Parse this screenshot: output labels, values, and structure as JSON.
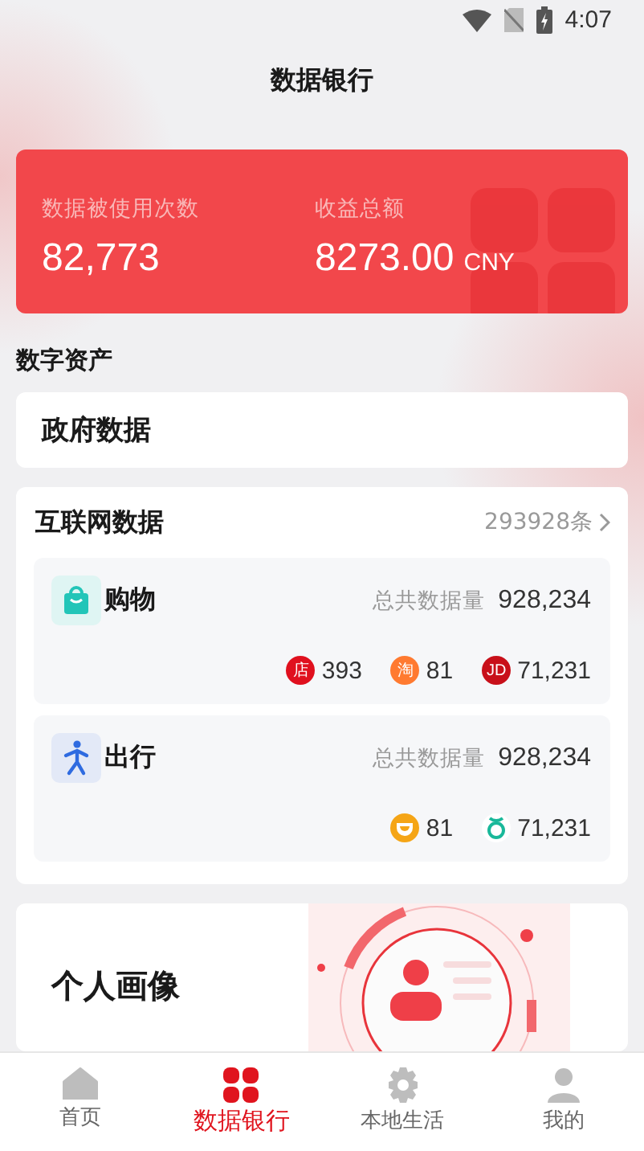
{
  "status_bar": {
    "time": "4:07"
  },
  "header": {
    "title": "数据银行"
  },
  "summary": {
    "stats": [
      {
        "label": "数据被使用次数",
        "value": "82,773"
      },
      {
        "label": "收益总额",
        "value": "8273.00",
        "unit": "CNY"
      }
    ]
  },
  "section_title": "数字资产",
  "government": {
    "title": "政府数据"
  },
  "internet": {
    "title": "互联网数据",
    "count": "293928条",
    "categories": [
      {
        "kind": "shopping",
        "name": "购物",
        "total_label": "总共数据量",
        "total": "928,234",
        "sources": [
          {
            "kind": "store",
            "badge": "店",
            "value": "393"
          },
          {
            "kind": "taobao",
            "badge": "淘",
            "value": "81"
          },
          {
            "kind": "jd",
            "badge": "JD",
            "value": "71,231"
          }
        ]
      },
      {
        "kind": "travel",
        "name": "出行",
        "total_label": "总共数据量",
        "total": "928,234",
        "sources": [
          {
            "kind": "didi",
            "value": "81"
          },
          {
            "kind": "ring",
            "value": "71,231"
          }
        ]
      }
    ]
  },
  "portrait": {
    "title": "个人画像"
  },
  "nav": [
    {
      "kind": "home",
      "label": "首页",
      "selected": false
    },
    {
      "kind": "grid",
      "label": "数据银行",
      "selected": true
    },
    {
      "kind": "gear",
      "label": "本地生活",
      "selected": false
    },
    {
      "kind": "person",
      "label": "我的",
      "selected": false
    }
  ]
}
